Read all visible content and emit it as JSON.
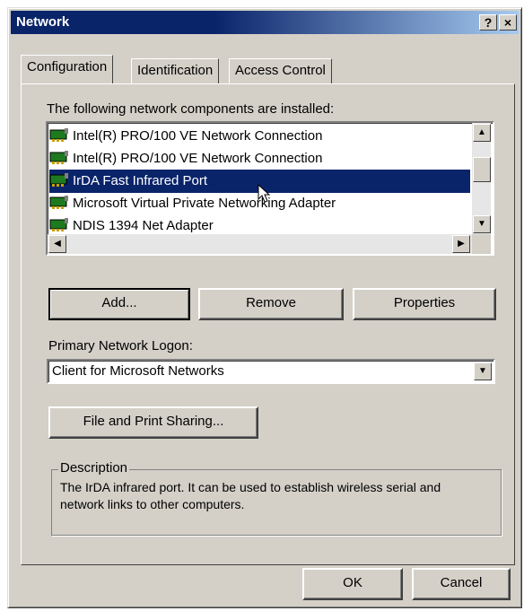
{
  "window": {
    "title": "Network",
    "help": "?",
    "close": "×"
  },
  "tabs": [
    "Configuration",
    "Identification",
    "Access Control"
  ],
  "components": {
    "label": "The following network components are installed:",
    "items": [
      "Intel(R) PRO/100 VE Network Connection",
      "Intel(R) PRO/100 VE Network Connection",
      "IrDA Fast Infrared Port",
      "Microsoft Virtual Private Networking Adapter",
      "NDIS 1394 Net Adapter"
    ],
    "selected_index": 2
  },
  "buttons": {
    "add": "Add...",
    "remove": "Remove",
    "properties": "Properties",
    "sharing": "File and Print Sharing...",
    "ok": "OK",
    "cancel": "Cancel"
  },
  "logon": {
    "label": "Primary Network Logon:",
    "value": "Client for Microsoft Networks"
  },
  "description": {
    "legend": "Description",
    "text": "The IrDA infrared port.  It can be used to establish wireless serial and network links to other computers."
  },
  "colors": {
    "selection": "#0a246a",
    "face": "#d4d0c8",
    "nic_icon": "#1e7a1e"
  }
}
